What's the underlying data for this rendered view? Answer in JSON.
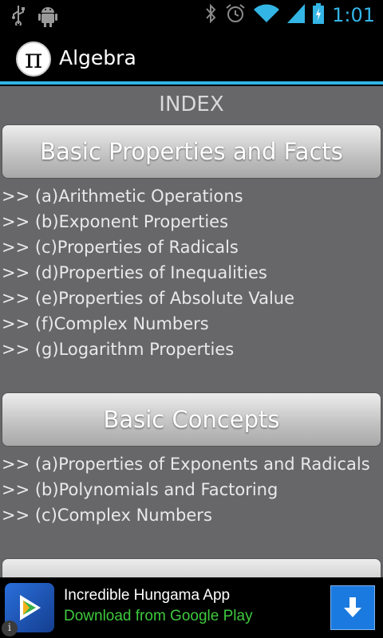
{
  "status_bar": {
    "time": "1:01",
    "icons": [
      "usb-icon",
      "android-debug-icon",
      "bluetooth-icon",
      "alarm-icon",
      "wifi-icon",
      "signal-icon",
      "battery-charging-icon"
    ],
    "accent": "#33b5e5"
  },
  "action_bar": {
    "logo_icon": "pi-icon",
    "logo_glyph": "π",
    "title": "Algebra"
  },
  "main": {
    "index_title": "INDEX",
    "sections": [
      {
        "title": "Basic Properties and Facts",
        "items": [
          ">> (a)Arithmetic Operations",
          ">> (b)Exponent Properties",
          ">> (c)Properties of Radicals",
          ">> (d)Properties of Inequalities",
          ">> (e)Properties of Absolute Value",
          ">> (f)Complex Numbers",
          ">> (g)Logarithm Properties"
        ]
      },
      {
        "title": "Basic Concepts",
        "items": [
          ">> (a)Properties of Exponents and Radicals",
          ">> (b)Polynomials and Factoring",
          ">> (c)Complex Numbers"
        ]
      }
    ]
  },
  "ad_banner": {
    "icon": "play-store-app-icon",
    "title": "Incredible Hungama App",
    "subtitle": "Download from Google Play",
    "download_icon": "download-arrow-icon",
    "info_icon": "info-icon",
    "info_glyph": "i",
    "subtitle_color": "#3ec93e",
    "download_color": "#1b7ae0"
  }
}
